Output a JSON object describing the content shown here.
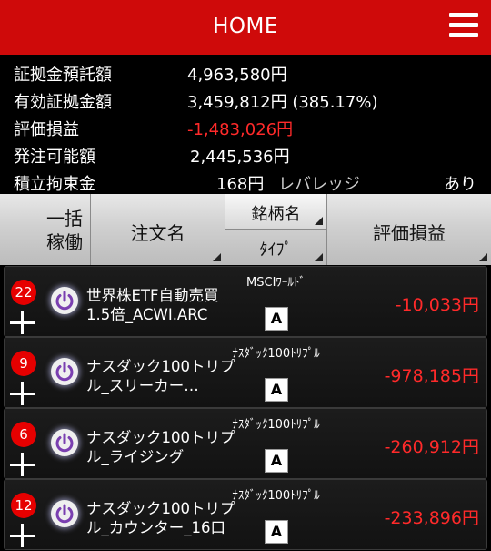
{
  "header": {
    "title": "HOME"
  },
  "summary": {
    "margin_deposit": {
      "label": "証拠金預託額",
      "value": "4,963,580円"
    },
    "effective_margin": {
      "label": "有効証拠金額",
      "value": "3,459,812円 (385.17%)"
    },
    "valuation_pl": {
      "label": "評価損益",
      "value": "-1,483,026円"
    },
    "order_available": {
      "label": "発注可能額",
      "value": "2,445,536円"
    },
    "accumulation": {
      "label": "積立拘束金",
      "value": "168円",
      "leverage_label": "レバレッジ",
      "leverage_value": "あり"
    }
  },
  "columns": {
    "batch_run": "一括\n稼働",
    "order_name": "注文名",
    "brand": "銘柄名",
    "type": "ﾀｲﾌﾟ",
    "valuation": "評価損益"
  },
  "rows": [
    {
      "count": "22",
      "name": "世界株ETF自動売買1.5倍_ACWI.ARC",
      "brand": "MSCIﾜｰﾙﾄﾞ",
      "type": "A",
      "pl": "-10,033円"
    },
    {
      "count": "9",
      "name": "ナスダック100トリプル_スリーカー…",
      "brand": "ﾅｽﾀﾞｯｸ100ﾄﾘﾌﾟﾙ",
      "type": "A",
      "pl": "-978,185円"
    },
    {
      "count": "6",
      "name": "ナスダック100トリプル_ライジング",
      "brand": "ﾅｽﾀﾞｯｸ100ﾄﾘﾌﾟﾙ",
      "type": "A",
      "pl": "-260,912円"
    },
    {
      "count": "12",
      "name": "ナスダック100トリプル_カウンター_16口",
      "brand": "ﾅｽﾀﾞｯｸ100ﾄﾘﾌﾟﾙ",
      "type": "A",
      "pl": "-233,896円"
    }
  ],
  "colors": {
    "header": "#cf0a0a",
    "negative": "#ff2a2a",
    "badge": "#e60000",
    "power_icon": "#7a3fb0"
  }
}
